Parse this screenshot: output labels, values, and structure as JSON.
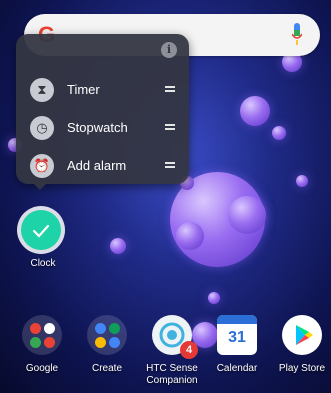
{
  "search": {
    "logo_letter": "G",
    "icon_left": "google-icon",
    "icon_right": "mic-icon"
  },
  "popup": {
    "info_icon": "i",
    "shortcuts": [
      {
        "label": "Timer",
        "icon": "hourglass-icon",
        "glyph": "⧗"
      },
      {
        "label": "Stopwatch",
        "icon": "stopwatch-icon",
        "glyph": "◷"
      },
      {
        "label": "Add alarm",
        "icon": "alarm-icon",
        "glyph": "⏰"
      }
    ]
  },
  "home": {
    "clock_app_label": "Clock"
  },
  "dock": [
    {
      "label": "Google",
      "type": "folder"
    },
    {
      "label": "Create",
      "type": "folder"
    },
    {
      "label": "HTC Sense Companion",
      "type": "app",
      "badge": "4"
    },
    {
      "label": "Calendar",
      "type": "app",
      "icon_text": "31"
    },
    {
      "label": "Play Store",
      "type": "app"
    }
  ]
}
